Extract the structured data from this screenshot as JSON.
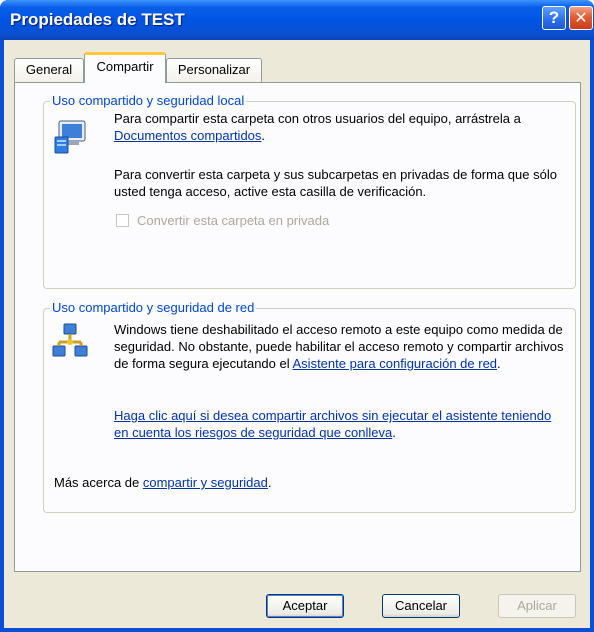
{
  "window": {
    "title": "Propiedades de TEST",
    "help_glyph": "?",
    "close_glyph": "✕"
  },
  "tabs": [
    {
      "label": "General",
      "active": false
    },
    {
      "label": "Compartir",
      "active": true
    },
    {
      "label": "Personalizar",
      "active": false
    }
  ],
  "local_sharing": {
    "heading": "Uso compartido y seguridad local",
    "icon": "computer-icon",
    "p1_text": "Para compartir esta carpeta con otros usuarios del equipo, arrástrela a ",
    "p1_link": "Documentos compartidos",
    "p1_end": ".",
    "p2_text": "Para convertir esta carpeta y sus subcarpetas en privadas de forma que sólo usted tenga acceso, active esta casilla de verificación.",
    "private_checkbox_label": "Convertir esta carpeta en privada",
    "private_checkbox_checked": false,
    "private_checkbox_enabled": false
  },
  "network_sharing": {
    "heading": "Uso compartido y seguridad de red",
    "icon": "network-icon",
    "p1_text": "Windows tiene deshabilitado el acceso remoto a este equipo como medida de seguridad. No obstante, puede habilitar el acceso remoto y compartir archivos de forma segura ejecutando el ",
    "p1_link": "Asistente para configuración de red",
    "p1_end": ".",
    "risk_link": "Haga clic aquí si desea compartir archivos sin ejecutar el asistente teniendo en cuenta los riesgos de seguridad que conlleva",
    "risk_end": ".",
    "more_text": "Más acerca de ",
    "more_link": "compartir y seguridad",
    "more_end": "."
  },
  "buttons": {
    "ok": "Aceptar",
    "cancel": "Cancelar",
    "apply": "Aplicar"
  },
  "colors": {
    "title_bar": "#0054e3",
    "dialog_bg": "#ece9d8",
    "group_heading": "#0046d5",
    "link": "#0033aa",
    "active_tab_accent": "#ffc83c"
  }
}
